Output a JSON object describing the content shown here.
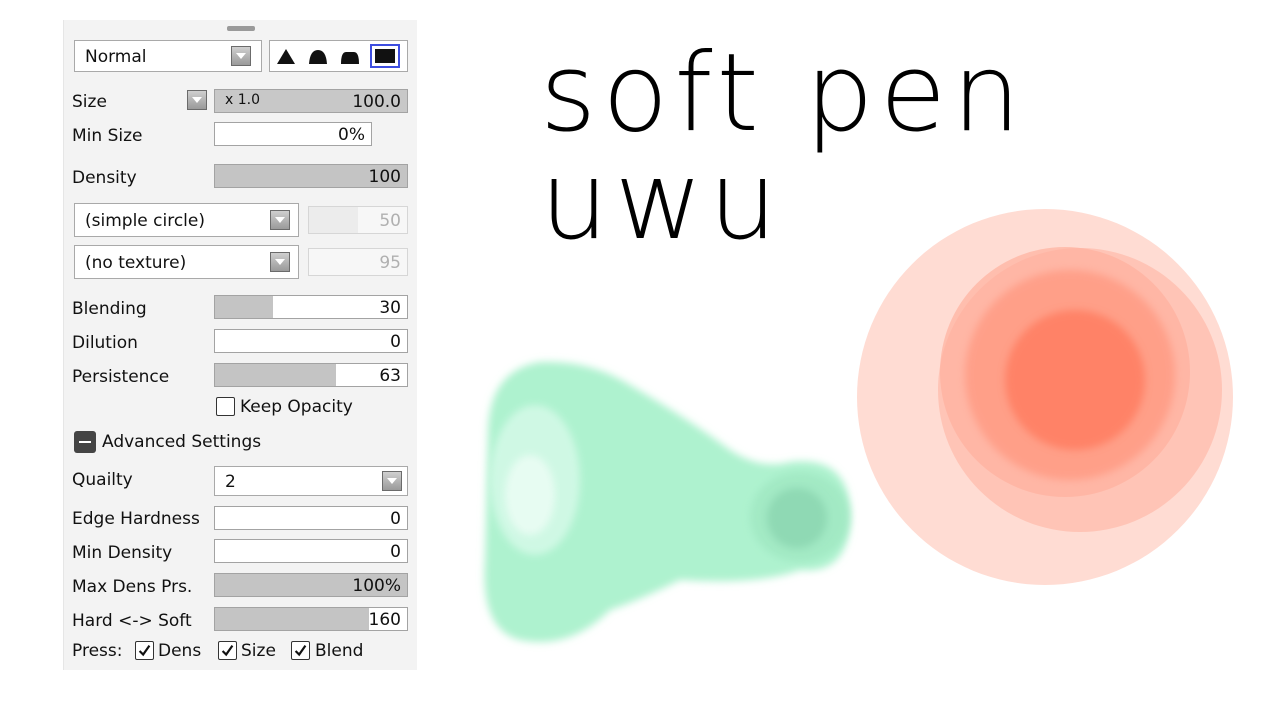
{
  "panel": {
    "blend_mode": "Normal",
    "size": {
      "label": "Size",
      "multiplier": "x 1.0",
      "value": "100.0"
    },
    "min_size": {
      "label": "Min Size",
      "value": "0%"
    },
    "density": {
      "label": "Density",
      "value": "100",
      "fill": 1.0
    },
    "brush_shape": {
      "value": "(simple circle)",
      "amount": "50"
    },
    "texture": {
      "value": "(no texture)",
      "amount": "95"
    },
    "blending": {
      "label": "Blending",
      "value": "30",
      "fill": 0.3
    },
    "dilution": {
      "label": "Dilution",
      "value": "0",
      "fill": 0
    },
    "persistence": {
      "label": "Persistence",
      "value": "63",
      "fill": 0.63
    },
    "keep_opacity": {
      "label": "Keep Opacity",
      "checked": false
    },
    "advanced": {
      "label": "Advanced Settings"
    },
    "quality": {
      "label": "Quailty",
      "value": "2"
    },
    "edge_hardness": {
      "label": "Edge Hardness",
      "value": "0",
      "fill": 0
    },
    "min_density": {
      "label": "Min Density",
      "value": "0",
      "fill": 0
    },
    "max_dens_prs": {
      "label": "Max Dens Prs.",
      "value": "100%",
      "fill": 1.0
    },
    "hard_soft": {
      "label": "Hard <-> Soft",
      "value": "160",
      "fill": 0.8
    },
    "press": {
      "label": "Press:",
      "dens": "Dens",
      "size": "Size",
      "blend": "Blend"
    }
  },
  "canvas": {
    "handwriting": "soft pen uwu",
    "colors": {
      "green": "#a8f0cc",
      "red": "#ff7a5c",
      "pink": "#ffd8cf"
    }
  }
}
